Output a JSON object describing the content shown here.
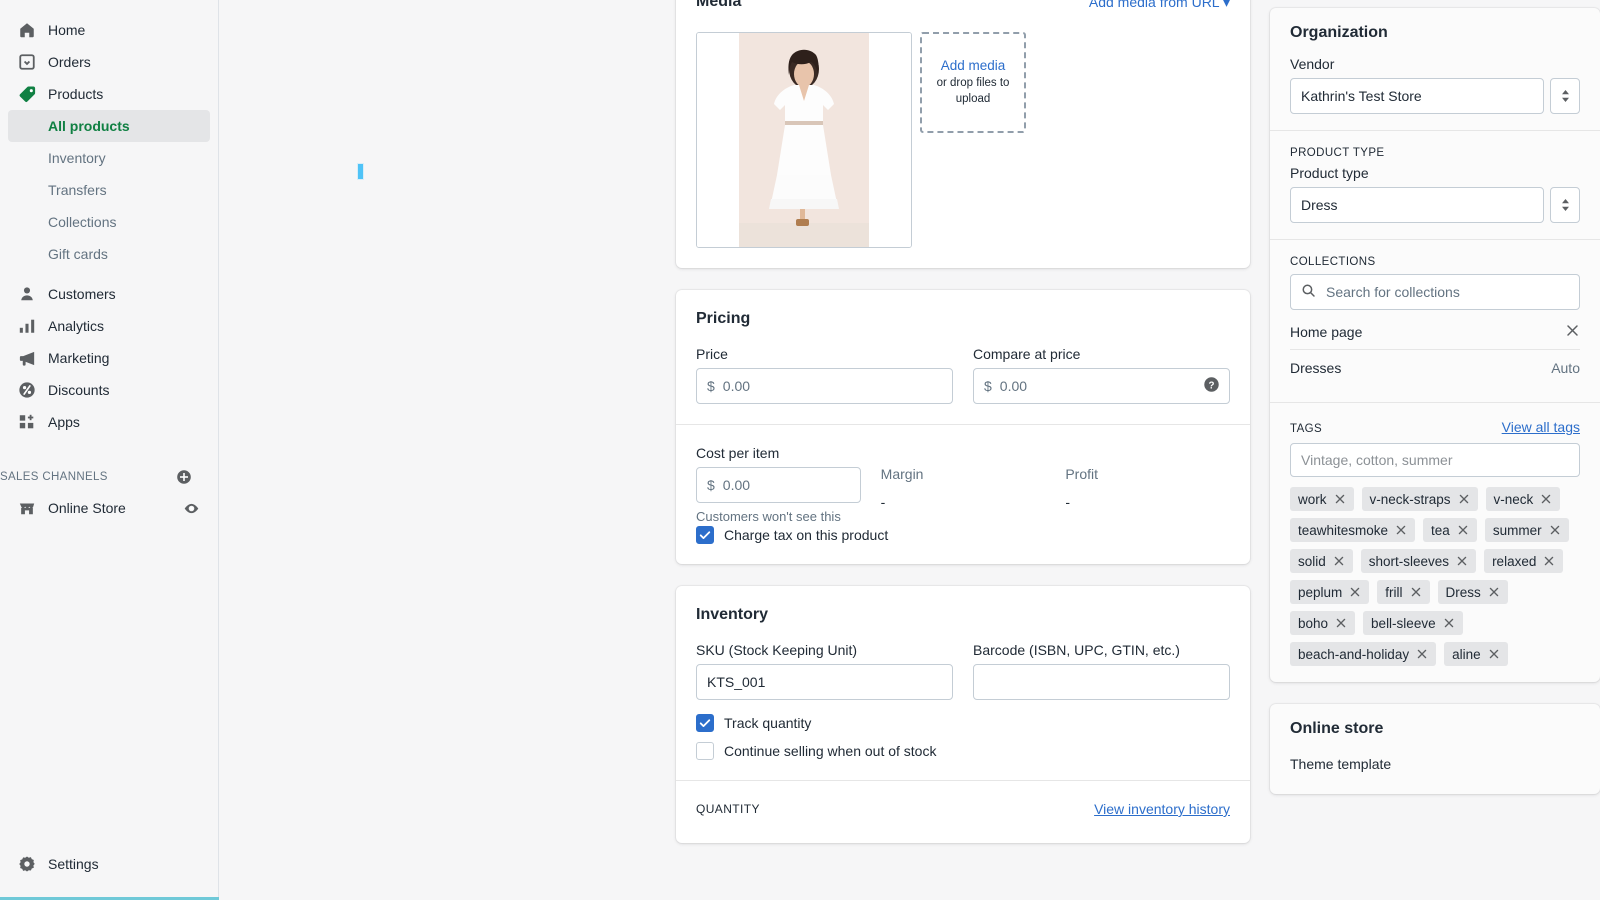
{
  "sidebar": {
    "items": [
      {
        "label": "Home",
        "icon": "home-icon"
      },
      {
        "label": "Orders",
        "icon": "orders-icon"
      },
      {
        "label": "Products",
        "icon": "products-tag-icon"
      }
    ],
    "product_subitems": [
      {
        "label": "All products",
        "active": true
      },
      {
        "label": "Inventory",
        "active": false
      },
      {
        "label": "Transfers",
        "active": false
      },
      {
        "label": "Collections",
        "active": false
      },
      {
        "label": "Gift cards",
        "active": false
      }
    ],
    "items2": [
      {
        "label": "Customers",
        "icon": "customer-person-icon"
      },
      {
        "label": "Analytics",
        "icon": "analytics-bars-icon"
      },
      {
        "label": "Marketing",
        "icon": "marketing-megaphone-icon"
      },
      {
        "label": "Discounts",
        "icon": "discounts-percent-icon"
      },
      {
        "label": "Apps",
        "icon": "apps-grid-icon"
      }
    ],
    "sales_channels_header": "SALES CHANNELS",
    "online_store": "Online Store",
    "settings": "Settings"
  },
  "media": {
    "title": "Media",
    "add_from_url": "Add media from URL",
    "add_media_link": "Add media",
    "drop_hint": "or drop files to upload",
    "image_alt": "White midi dress on model"
  },
  "pricing": {
    "title": "Pricing",
    "price_label": "Price",
    "price_currency": "$",
    "price_value": "0.00",
    "compare_label": "Compare at price",
    "compare_currency": "$",
    "compare_value": "0.00",
    "cost_label": "Cost per item",
    "cost_currency": "$",
    "cost_value": "0.00",
    "cost_hint": "Customers won't see this",
    "margin_label": "Margin",
    "margin_value": "-",
    "profit_label": "Profit",
    "profit_value": "-",
    "charge_tax_label": "Charge tax on this product",
    "charge_tax_checked": true
  },
  "inventory": {
    "title": "Inventory",
    "sku_label": "SKU (Stock Keeping Unit)",
    "sku_value": "KTS_001",
    "barcode_label": "Barcode (ISBN, UPC, GTIN, etc.)",
    "barcode_value": "",
    "track_quantity_label": "Track quantity",
    "track_quantity_checked": true,
    "continue_selling_label": "Continue selling when out of stock",
    "continue_selling_checked": false,
    "quantity_header": "QUANTITY",
    "view_history_link": "View inventory history"
  },
  "organization": {
    "title": "Organization",
    "vendor_label": "Vendor",
    "vendor_value": "Kathrin's Test Store",
    "product_type_caps": "PRODUCT TYPE",
    "product_type_label": "Product type",
    "product_type_value": "Dress",
    "collections_caps": "COLLECTIONS",
    "collections_placeholder": "Search for collections",
    "collections": [
      {
        "name": "Home page",
        "status": "",
        "removable": true
      },
      {
        "name": "Dresses",
        "status": "Auto",
        "removable": false
      }
    ],
    "tags_caps": "TAGS",
    "view_all_tags": "View all tags",
    "tags_placeholder": "Vintage, cotton, summer",
    "tags": [
      "work",
      "v-neck-straps",
      "v-neck",
      "teawhitesmoke",
      "tea",
      "summer",
      "solid",
      "short-sleeves",
      "relaxed",
      "peplum",
      "frill",
      "Dress",
      "boho",
      "bell-sleeve",
      "beach-and-holiday",
      "aline"
    ]
  },
  "online_store": {
    "title": "Online store",
    "theme_template_label": "Theme template"
  },
  "colors": {
    "accent_green": "#108043",
    "link_blue": "#2c6ecb",
    "checkbox_blue": "#2c6ecb",
    "sidebar_bg": "#f6f6f7",
    "caret_blue": "#4fc3f7"
  }
}
